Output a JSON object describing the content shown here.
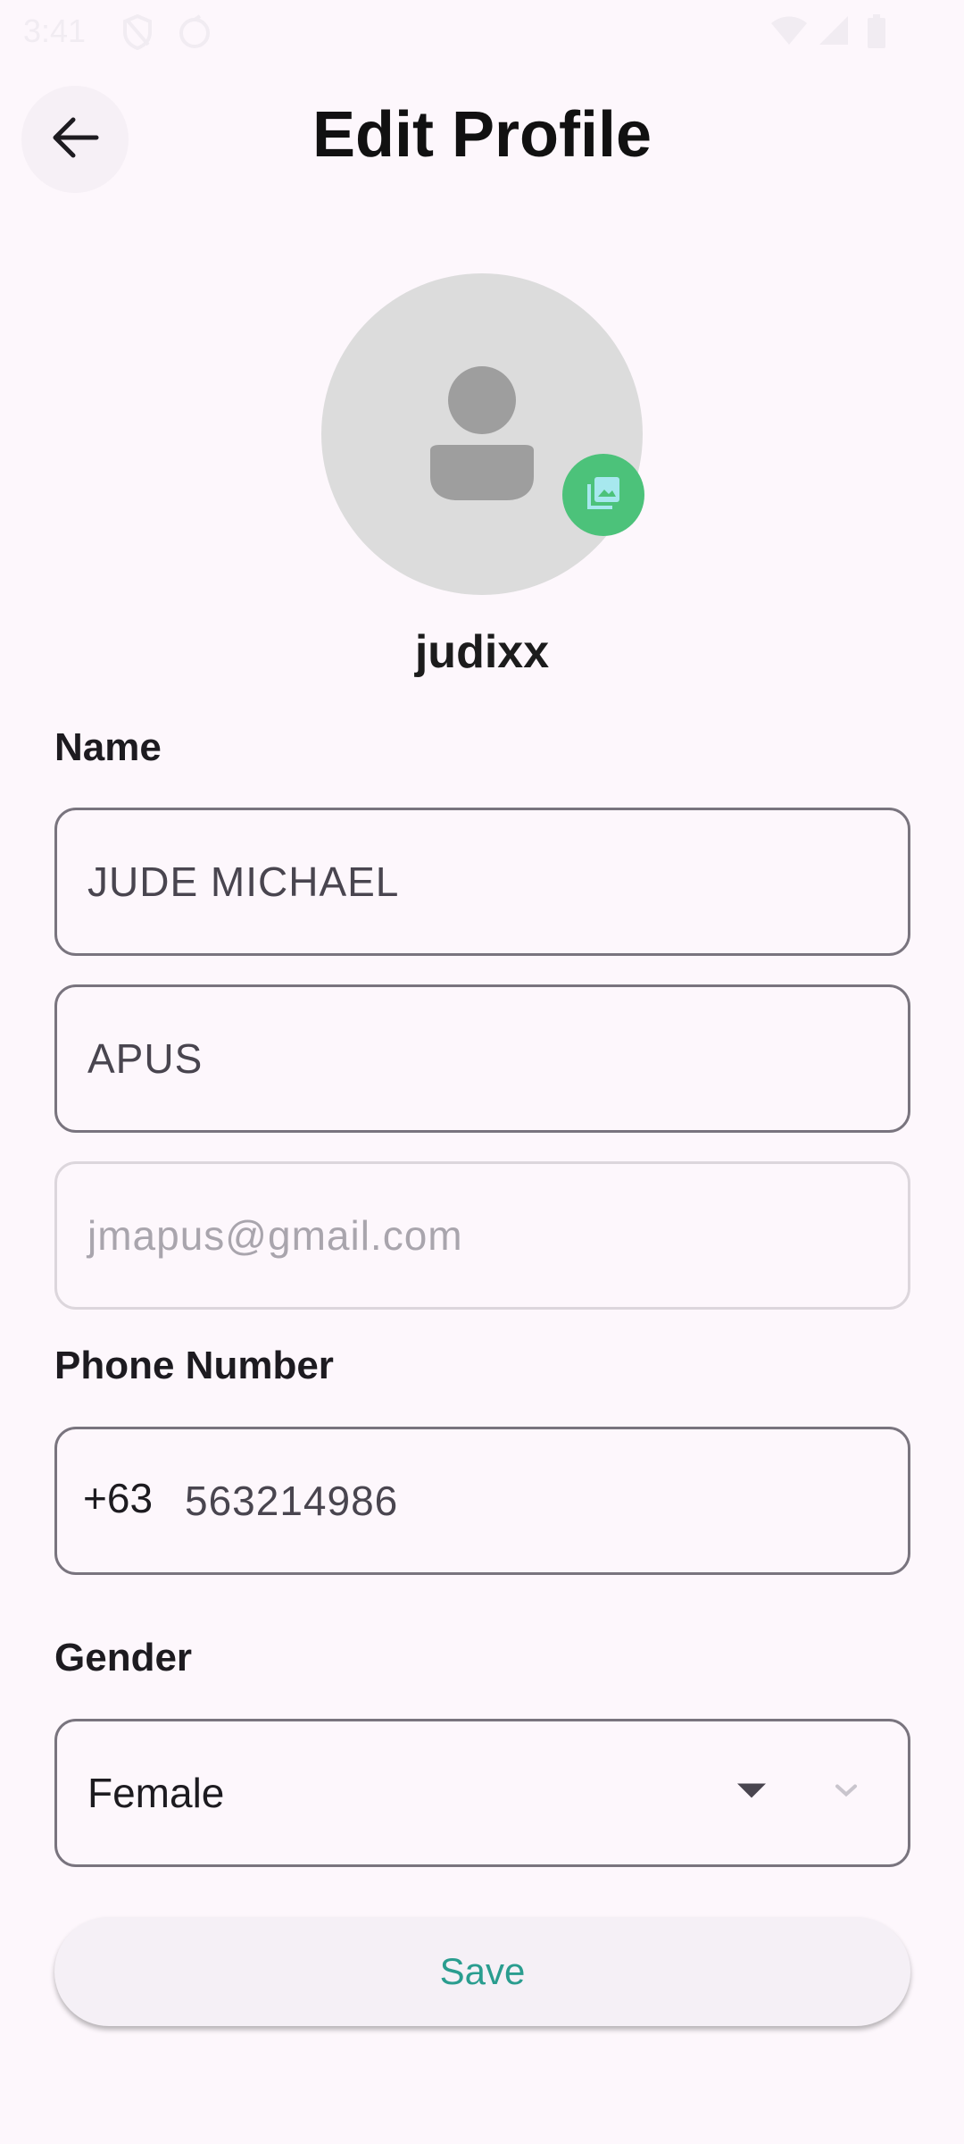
{
  "status_bar": {
    "time": "3:41",
    "icons": [
      "shield-icon",
      "sync-icon",
      "wifi-icon",
      "signal-icon",
      "battery-icon"
    ]
  },
  "header": {
    "title": "Edit Profile",
    "back_icon": "arrow-left-icon"
  },
  "profile": {
    "username": "judixx",
    "avatar_icon": "person-placeholder-icon",
    "edit_photo_icon": "image-gallery-icon",
    "edit_photo_color": "#4cc27a"
  },
  "name_section": {
    "label": "Name",
    "first_name": "JUDE MICHAEL",
    "last_name": "APUS",
    "email": "jmapus@gmail.com"
  },
  "phone_section": {
    "label": "Phone Number",
    "prefix": "+63",
    "number": "563214986"
  },
  "gender_section": {
    "label": "Gender",
    "selected": "Female"
  },
  "actions": {
    "save_label": "Save",
    "save_color": "#2a9d8f"
  }
}
